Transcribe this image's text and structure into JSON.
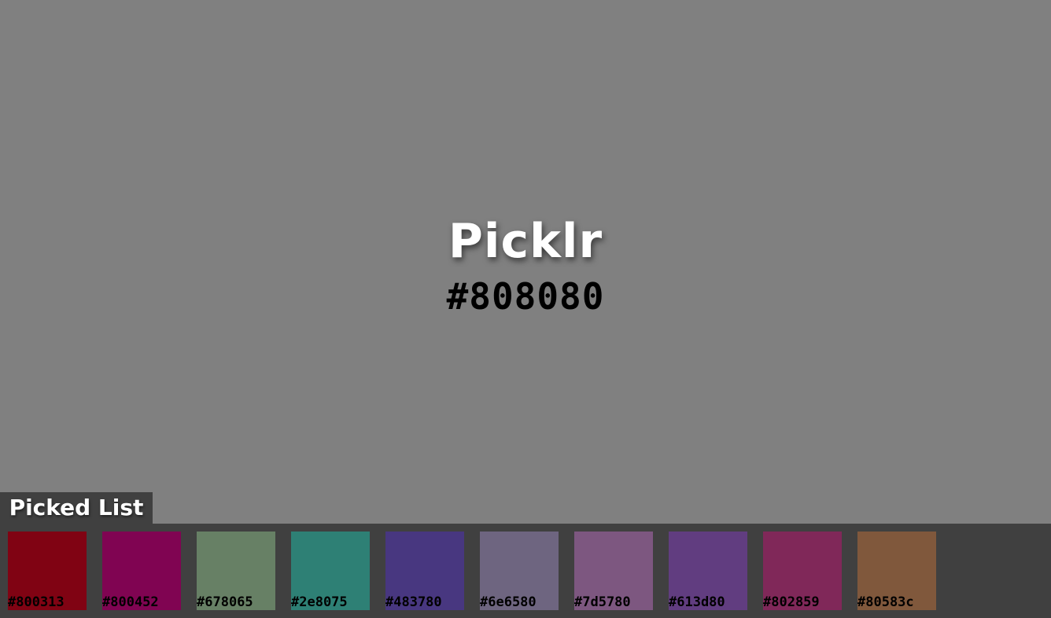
{
  "app": {
    "title": "Picklr",
    "current_color": "#808080",
    "current_hex_label": "#808080"
  },
  "picked_list": {
    "heading": "Picked List",
    "items": [
      {
        "hex": "#800313",
        "label": "#800313"
      },
      {
        "hex": "#800452",
        "label": "#800452"
      },
      {
        "hex": "#678065",
        "label": "#678065"
      },
      {
        "hex": "#2e8075",
        "label": "#2e8075"
      },
      {
        "hex": "#483780",
        "label": "#483780"
      },
      {
        "hex": "#6e6580",
        "label": "#6e6580"
      },
      {
        "hex": "#7d5780",
        "label": "#7d5780"
      },
      {
        "hex": "#613d80",
        "label": "#613d80"
      },
      {
        "hex": "#802859",
        "label": "#802859"
      },
      {
        "hex": "#80583c",
        "label": "#80583c"
      }
    ]
  },
  "colors": {
    "panel_background": "#404040",
    "title_text": "#ffffff",
    "hex_text": "#000000"
  }
}
